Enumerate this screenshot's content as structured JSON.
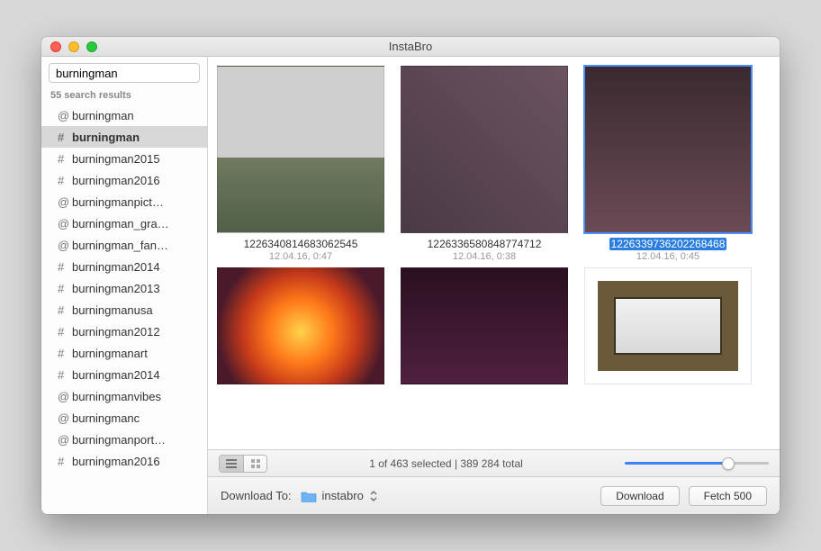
{
  "title": "InstaBro",
  "search": {
    "value": "burningman",
    "results_label": "55 search results",
    "items": [
      {
        "prefix": "@",
        "label": "burningman",
        "selected": false
      },
      {
        "prefix": "#",
        "label": "burningman",
        "selected": true
      },
      {
        "prefix": "#",
        "label": "burningman2015",
        "selected": false
      },
      {
        "prefix": "#",
        "label": "burningman2016",
        "selected": false
      },
      {
        "prefix": "@",
        "label": "burningmanpict…",
        "selected": false
      },
      {
        "prefix": "@",
        "label": "burningman_gra…",
        "selected": false
      },
      {
        "prefix": "@",
        "label": "burningman_fan…",
        "selected": false
      },
      {
        "prefix": "#",
        "label": "burningman2014",
        "selected": false
      },
      {
        "prefix": "#",
        "label": "burningman2013",
        "selected": false
      },
      {
        "prefix": "#",
        "label": "burningmanusa",
        "selected": false
      },
      {
        "prefix": "#",
        "label": "burningman2012",
        "selected": false
      },
      {
        "prefix": "#",
        "label": "burningmanart",
        "selected": false
      },
      {
        "prefix": "#",
        "label": "burningman2014",
        "selected": false
      },
      {
        "prefix": "@",
        "label": "burningmanvibes",
        "selected": false
      },
      {
        "prefix": "@",
        "label": "burningmanc",
        "selected": false
      },
      {
        "prefix": "@",
        "label": "burningmanport…",
        "selected": false
      },
      {
        "prefix": "#",
        "label": "burningman2016",
        "selected": false
      }
    ]
  },
  "grid": {
    "row1": [
      {
        "id": "1226340814683062545",
        "date": "12.04.16, 0:47",
        "selected": false,
        "ph": "ph1"
      },
      {
        "id": "1226336580848774712",
        "date": "12.04.16, 0:38",
        "selected": false,
        "ph": "ph2"
      },
      {
        "id": "1226339736202268468",
        "date": "12.04.16, 0:45",
        "selected": true,
        "ph": "ph3"
      }
    ],
    "row2": [
      {
        "ph": "ph4"
      },
      {
        "ph": "ph5"
      },
      {
        "ph": "ph6"
      }
    ]
  },
  "status": {
    "text": "1 of 463 selected   |   389 284 total"
  },
  "download": {
    "label": "Download To:",
    "folder": "instabro",
    "download_btn": "Download",
    "fetch_btn": "Fetch 500"
  }
}
